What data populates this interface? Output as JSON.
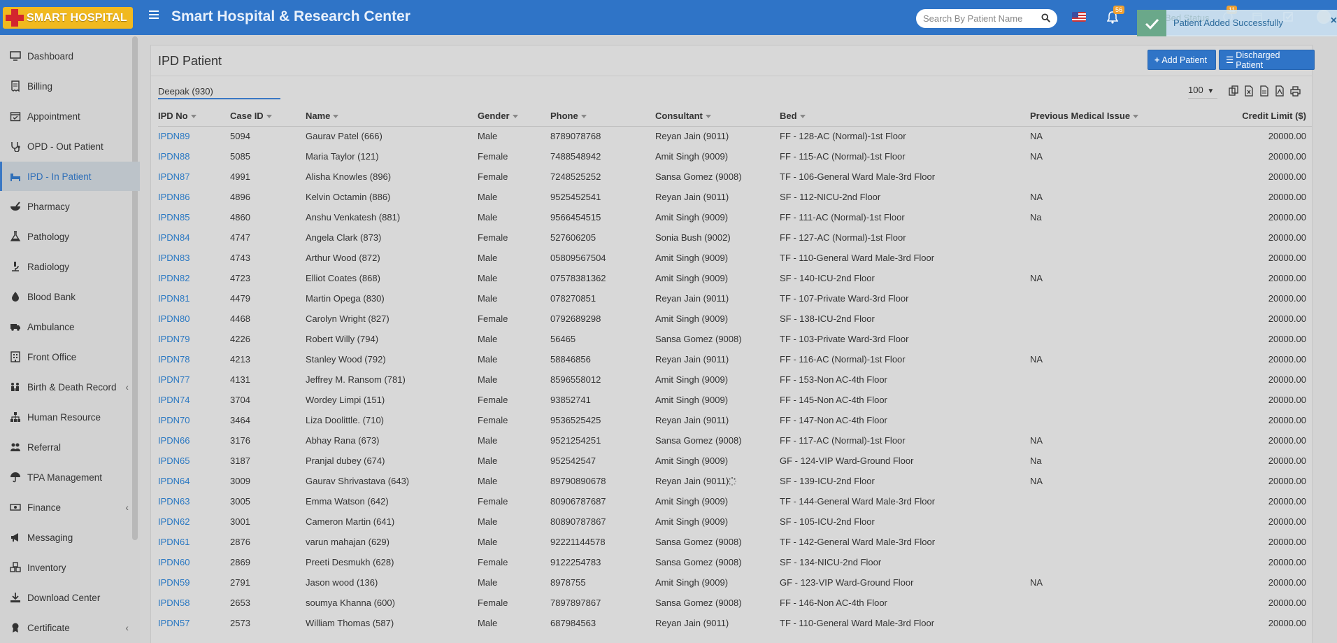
{
  "header": {
    "logo_text": "SMART HOSPITAL",
    "title": "Smart Hospital & Research Center",
    "search_placeholder": "Search By Patient Name",
    "notification_count": "56",
    "second_badge": "11"
  },
  "toast": {
    "message": "Patient Added Successfully",
    "close": "×",
    "underlay_text": "Bed Status"
  },
  "sidebar": {
    "items": [
      {
        "label": "Dashboard",
        "icon": "monitor-icon"
      },
      {
        "label": "Billing",
        "icon": "receipt-icon"
      },
      {
        "label": "Appointment",
        "icon": "calendar-check-icon"
      },
      {
        "label": "OPD - Out Patient",
        "icon": "stethoscope-icon"
      },
      {
        "label": "IPD - In Patient",
        "icon": "bed-icon"
      },
      {
        "label": "Pharmacy",
        "icon": "mortar-pestle-icon"
      },
      {
        "label": "Pathology",
        "icon": "flask-icon"
      },
      {
        "label": "Radiology",
        "icon": "microscope-icon"
      },
      {
        "label": "Blood Bank",
        "icon": "droplet-icon"
      },
      {
        "label": "Ambulance",
        "icon": "ambulance-icon"
      },
      {
        "label": "Front Office",
        "icon": "building-icon"
      },
      {
        "label": "Birth & Death Record",
        "icon": "family-icon"
      },
      {
        "label": "Human Resource",
        "icon": "sitemap-icon"
      },
      {
        "label": "Referral",
        "icon": "users-icon"
      },
      {
        "label": "TPA Management",
        "icon": "umbrella-icon"
      },
      {
        "label": "Finance",
        "icon": "money-icon"
      },
      {
        "label": "Messaging",
        "icon": "bullhorn-icon"
      },
      {
        "label": "Inventory",
        "icon": "boxes-icon"
      },
      {
        "label": "Download Center",
        "icon": "download-icon"
      },
      {
        "label": "Certificate",
        "icon": "certificate-icon"
      }
    ],
    "active_index": 4,
    "chevron": "‹"
  },
  "main": {
    "title": "IPD Patient",
    "add_button": "Add Patient",
    "discharged_button": "Discharged Patient",
    "filter_value": "Deepak (930)",
    "page_size": "100",
    "columns": [
      "IPD No",
      "Case ID",
      "Name",
      "Gender",
      "Phone",
      "Consultant",
      "Bed",
      "Previous Medical Issue",
      "Credit Limit ($)"
    ],
    "rows": [
      [
        "IPDN89",
        "5094",
        "Gaurav Patel (666)",
        "Male",
        "8789078768",
        "Reyan Jain (9011)",
        "FF - 128-AC (Normal)-1st Floor",
        "NA",
        "20000.00"
      ],
      [
        "IPDN88",
        "5085",
        "Maria Taylor (121)",
        "Female",
        "7488548942",
        "Amit Singh (9009)",
        "FF - 115-AC (Normal)-1st Floor",
        "NA",
        "20000.00"
      ],
      [
        "IPDN87",
        "4991",
        "Alisha Knowles (896)",
        "Female",
        "7248525252",
        "Sansa Gomez (9008)",
        "TF - 106-General Ward Male-3rd Floor",
        "",
        "20000.00"
      ],
      [
        "IPDN86",
        "4896",
        "Kelvin Octamin (886)",
        "Male",
        "9525452541",
        "Reyan Jain (9011)",
        "SF - 112-NICU-2nd Floor",
        "NA",
        "20000.00"
      ],
      [
        "IPDN85",
        "4860",
        "Anshu Venkatesh (881)",
        "Male",
        "9566454515",
        "Amit Singh (9009)",
        "FF - 111-AC (Normal)-1st Floor",
        "Na",
        "20000.00"
      ],
      [
        "IPDN84",
        "4747",
        "Angela Clark (873)",
        "Female",
        "527606205",
        "Sonia Bush (9002)",
        "FF - 127-AC (Normal)-1st Floor",
        "",
        "20000.00"
      ],
      [
        "IPDN83",
        "4743",
        "Arthur Wood (872)",
        "Male",
        "05809567504",
        "Amit Singh (9009)",
        "TF - 110-General Ward Male-3rd Floor",
        "",
        "20000.00"
      ],
      [
        "IPDN82",
        "4723",
        "Elliot Coates (868)",
        "Male",
        "07578381362",
        "Amit Singh (9009)",
        "SF - 140-ICU-2nd Floor",
        "NA",
        "20000.00"
      ],
      [
        "IPDN81",
        "4479",
        "Martin Opega (830)",
        "Male",
        "078270851",
        "Reyan Jain (9011)",
        "TF - 107-Private Ward-3rd Floor",
        "",
        "20000.00"
      ],
      [
        "IPDN80",
        "4468",
        "Carolyn Wright (827)",
        "Female",
        "0792689298",
        "Amit Singh (9009)",
        "SF - 138-ICU-2nd Floor",
        "",
        "20000.00"
      ],
      [
        "IPDN79",
        "4226",
        "Robert Willy (794)",
        "Male",
        "56465",
        "Sansa Gomez (9008)",
        "TF - 103-Private Ward-3rd Floor",
        "",
        "20000.00"
      ],
      [
        "IPDN78",
        "4213",
        "Stanley Wood (792)",
        "Male",
        "58846856",
        "Reyan Jain (9011)",
        "FF - 116-AC (Normal)-1st Floor",
        "NA",
        "20000.00"
      ],
      [
        "IPDN77",
        "4131",
        "Jeffrey M. Ransom (781)",
        "Male",
        "8596558012",
        "Amit Singh (9009)",
        "FF - 153-Non AC-4th Floor",
        "",
        "20000.00"
      ],
      [
        "IPDN74",
        "3704",
        "Wordey Limpi (151)",
        "Female",
        "93852741",
        "Amit Singh (9009)",
        "FF - 145-Non AC-4th Floor",
        "",
        "20000.00"
      ],
      [
        "IPDN70",
        "3464",
        "Liza Doolittle. (710)",
        "Female",
        "9536525425",
        "Reyan Jain (9011)",
        "FF - 147-Non AC-4th Floor",
        "",
        "20000.00"
      ],
      [
        "IPDN66",
        "3176",
        "Abhay Rana (673)",
        "Male",
        "9521254251",
        "Sansa Gomez (9008)",
        "FF - 117-AC (Normal)-1st Floor",
        "NA",
        "20000.00"
      ],
      [
        "IPDN65",
        "3187",
        "Pranjal dubey (674)",
        "Male",
        "952542547",
        "Amit Singh (9009)",
        "GF - 124-VIP Ward-Ground Floor",
        "Na",
        "20000.00"
      ],
      [
        "IPDN64",
        "3009",
        "Gaurav Shrivastava (643)",
        "Male",
        "89790890678",
        "Reyan Jain (9011)",
        "SF - 139-ICU-2nd Floor",
        "NA",
        "20000.00"
      ],
      [
        "IPDN63",
        "3005",
        "Emma Watson (642)",
        "Female",
        "80906787687",
        "Amit Singh (9009)",
        "TF - 144-General Ward Male-3rd Floor",
        "",
        "20000.00"
      ],
      [
        "IPDN62",
        "3001",
        "Cameron Martin (641)",
        "Male",
        "80890787867",
        "Amit Singh (9009)",
        "SF - 105-ICU-2nd Floor",
        "",
        "20000.00"
      ],
      [
        "IPDN61",
        "2876",
        "varun mahajan (629)",
        "Male",
        "92221144578",
        "Sansa Gomez (9008)",
        "TF - 142-General Ward Male-3rd Floor",
        "",
        "20000.00"
      ],
      [
        "IPDN60",
        "2869",
        "Preeti Desmukh (628)",
        "Female",
        "9122254783",
        "Sansa Gomez (9008)",
        "SF - 134-NICU-2nd Floor",
        "",
        "20000.00"
      ],
      [
        "IPDN59",
        "2791",
        "Jason wood (136)",
        "Male",
        "8978755",
        "Amit Singh (9009)",
        "GF - 123-VIP Ward-Ground Floor",
        "NA",
        "20000.00"
      ],
      [
        "IPDN58",
        "2653",
        "soumya Khanna (600)",
        "Female",
        "7897897867",
        "Sansa Gomez (9008)",
        "FF - 146-Non AC-4th Floor",
        "",
        "20000.00"
      ],
      [
        "IPDN57",
        "2573",
        "William Thomas (587)",
        "Male",
        "687984563",
        "Reyan Jain (9011)",
        "TF - 110-General Ward Male-3rd Floor",
        "",
        "20000.00"
      ]
    ]
  },
  "colors": {
    "header": "#2f74c7",
    "link": "#2a78c2",
    "overlay_gray": "#d3d3d3",
    "toast": "#d2e4f0"
  }
}
